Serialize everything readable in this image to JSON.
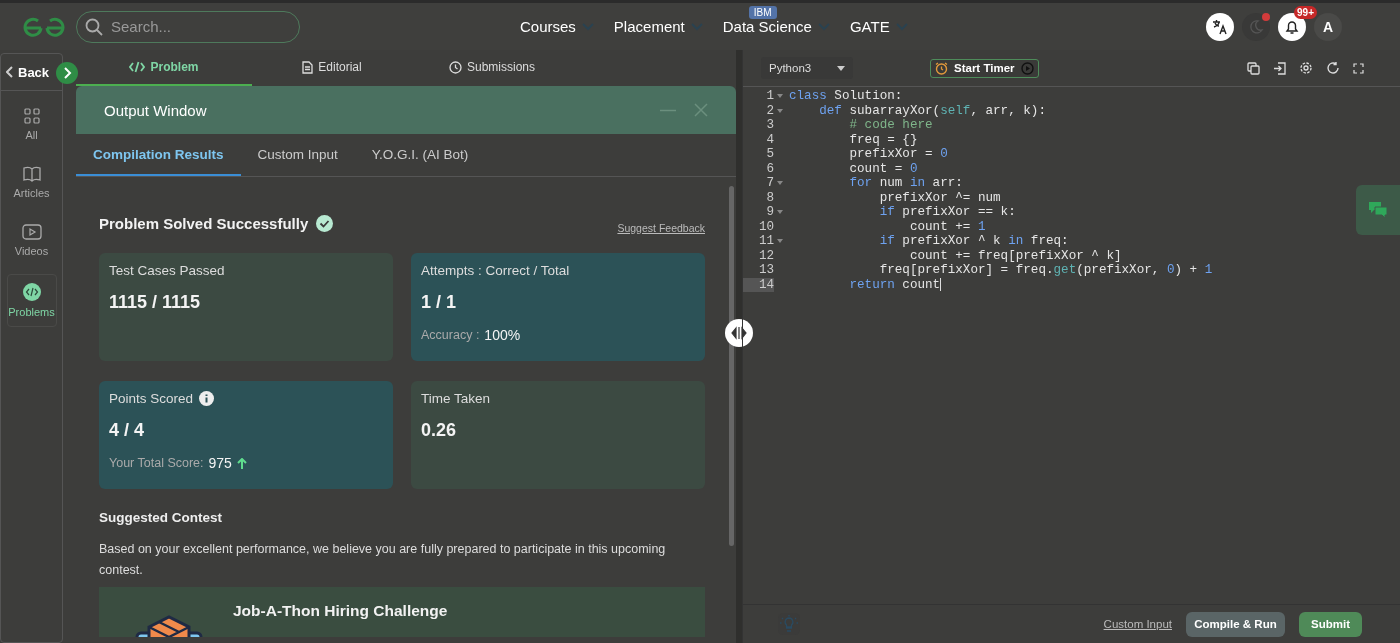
{
  "search": {
    "placeholder": "Search..."
  },
  "nav": [
    {
      "label": "Courses"
    },
    {
      "label": "Placement"
    },
    {
      "label": "Data Science",
      "badge": "IBM"
    },
    {
      "label": "GATE"
    }
  ],
  "header_actions": {
    "notification_badge": "99+",
    "theme_alert": true,
    "avatar": "A"
  },
  "sidebar": {
    "back": "Back",
    "items": [
      {
        "kind": "grid",
        "label": "All",
        "selected": false
      },
      {
        "kind": "book",
        "label": "Articles",
        "selected": false
      },
      {
        "kind": "video",
        "label": "Videos",
        "selected": false
      },
      {
        "kind": "code",
        "label": "Problems",
        "selected": true
      }
    ]
  },
  "problem_tabs": [
    {
      "kind": "code",
      "label": "Problem",
      "selected": true
    },
    {
      "kind": "doc",
      "label": "Editorial",
      "selected": false
    },
    {
      "kind": "clock",
      "label": "Submissions",
      "selected": false
    }
  ],
  "output_window": {
    "title": "Output Window",
    "tabs": [
      {
        "label": "Compilation Results",
        "selected": true
      },
      {
        "label": "Custom Input",
        "selected": false
      },
      {
        "label": "Y.O.G.I. (AI Bot)",
        "selected": false
      }
    ],
    "status": "Problem Solved Successfully",
    "feedback_link": "Suggest Feedback",
    "cards": [
      {
        "highlighted": false,
        "label": "Test Cases Passed",
        "value": "1115 / 1115"
      },
      {
        "highlighted": true,
        "label": "Attempts : Correct / Total",
        "value": "1 / 1",
        "extra_label": "Accuracy :",
        "extra_value": "100%"
      },
      {
        "highlighted": true,
        "label": "Points Scored",
        "info": true,
        "value": "4 / 4",
        "extra_label": "Your Total Score:",
        "extra_value": "975",
        "trend_up": true
      },
      {
        "highlighted": false,
        "label": "Time Taken",
        "value": "0.26"
      }
    ],
    "contest": {
      "heading": "Suggested Contest",
      "text": "Based on your excellent performance, we believe you are fully prepared to participate in this upcoming contest.",
      "title": "Job-A-Thon Hiring Challenge"
    }
  },
  "editor": {
    "language": "Python3",
    "timer": "Start Timer",
    "lines": [
      {
        "number": "1",
        "foldable": true,
        "current": false,
        "tokens": [
          {
            "kind": "keyword",
            "text": "class"
          },
          {
            "kind": "plain",
            "text": " Solution:"
          }
        ]
      },
      {
        "number": "2",
        "foldable": true,
        "current": false,
        "tokens": [
          {
            "kind": "keyword",
            "text": "    def"
          },
          {
            "kind": "plain",
            "text": " subarrayXor("
          },
          {
            "kind": "builtin",
            "text": "self"
          },
          {
            "kind": "plain",
            "text": ", arr, k):"
          }
        ]
      },
      {
        "number": "3",
        "foldable": false,
        "current": false,
        "tokens": [
          {
            "kind": "comment",
            "text": "        # code here"
          }
        ]
      },
      {
        "number": "4",
        "foldable": false,
        "current": false,
        "tokens": [
          {
            "kind": "plain",
            "text": "        freq = {}"
          }
        ]
      },
      {
        "number": "5",
        "foldable": false,
        "current": false,
        "tokens": [
          {
            "kind": "plain",
            "text": "        prefixXor = "
          },
          {
            "kind": "number",
            "text": "0"
          }
        ]
      },
      {
        "number": "6",
        "foldable": false,
        "current": false,
        "tokens": [
          {
            "kind": "plain",
            "text": "        count = "
          },
          {
            "kind": "number",
            "text": "0"
          }
        ]
      },
      {
        "number": "7",
        "foldable": true,
        "current": false,
        "tokens": [
          {
            "kind": "keyword",
            "text": "        for"
          },
          {
            "kind": "plain",
            "text": " num "
          },
          {
            "kind": "keyword",
            "text": "in"
          },
          {
            "kind": "plain",
            "text": " arr:"
          }
        ]
      },
      {
        "number": "8",
        "foldable": false,
        "current": false,
        "tokens": [
          {
            "kind": "plain",
            "text": "            prefixXor ^= num"
          }
        ]
      },
      {
        "number": "9",
        "foldable": true,
        "current": false,
        "tokens": [
          {
            "kind": "keyword",
            "text": "            if"
          },
          {
            "kind": "plain",
            "text": " prefixXor == k:"
          }
        ]
      },
      {
        "number": "10",
        "foldable": false,
        "current": false,
        "tokens": [
          {
            "kind": "plain",
            "text": "                count += "
          },
          {
            "kind": "number",
            "text": "1"
          }
        ]
      },
      {
        "number": "11",
        "foldable": true,
        "current": false,
        "tokens": [
          {
            "kind": "keyword",
            "text": "            if"
          },
          {
            "kind": "plain",
            "text": " prefixXor ^ k "
          },
          {
            "kind": "keyword",
            "text": "in"
          },
          {
            "kind": "plain",
            "text": " freq:"
          }
        ]
      },
      {
        "number": "12",
        "foldable": false,
        "current": false,
        "tokens": [
          {
            "kind": "plain",
            "text": "                count += freq[prefixXor ^ k]"
          }
        ]
      },
      {
        "number": "13",
        "foldable": false,
        "current": false,
        "tokens": [
          {
            "kind": "plain",
            "text": "            freq[prefixXor] = freq."
          },
          {
            "kind": "builtin",
            "text": "get"
          },
          {
            "kind": "plain",
            "text": "(prefixXor, "
          },
          {
            "kind": "number",
            "text": "0"
          },
          {
            "kind": "plain",
            "text": ") + "
          },
          {
            "kind": "number",
            "text": "1"
          }
        ]
      },
      {
        "number": "14",
        "foldable": false,
        "current": true,
        "tokens": [
          {
            "kind": "keyword",
            "text": "        return"
          },
          {
            "kind": "plain",
            "text": " count"
          }
        ]
      }
    ],
    "custom_input": "Custom Input",
    "compile": "Compile & Run",
    "submit": "Submit"
  }
}
